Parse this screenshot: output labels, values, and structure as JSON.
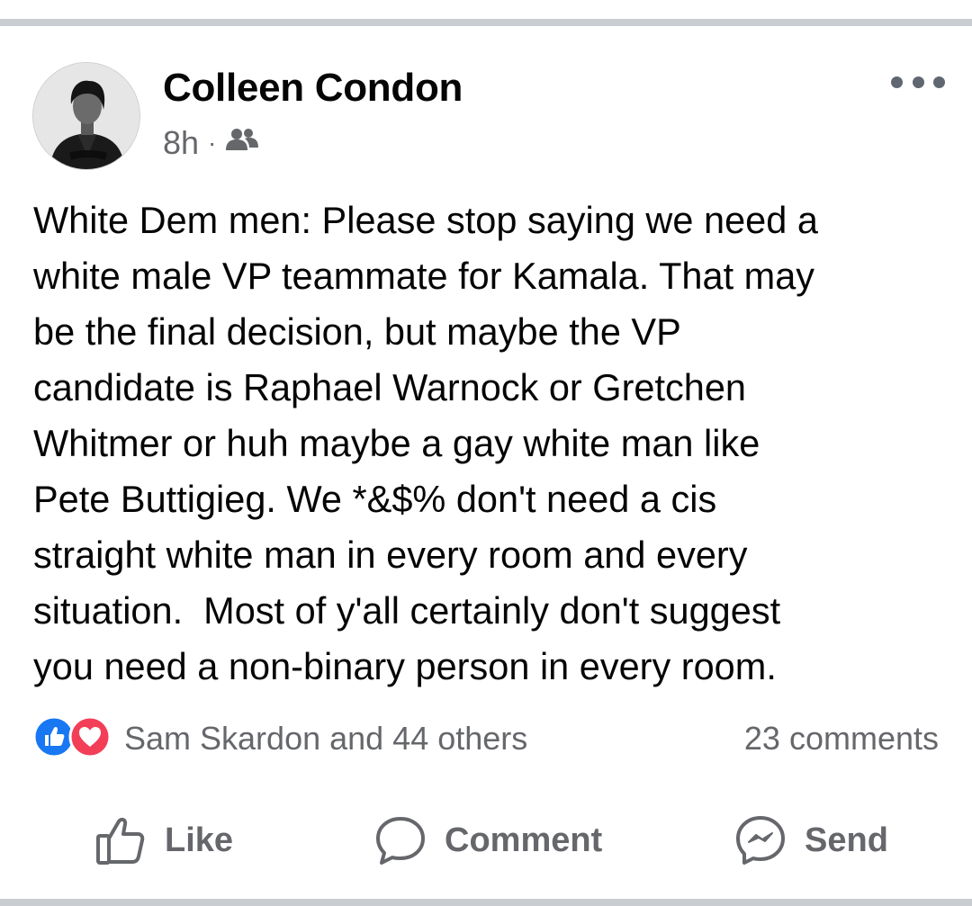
{
  "post": {
    "author_name": "Colleen Condon",
    "timestamp": "8h",
    "separator": "·",
    "audience_icon": "friends-icon",
    "text": "White Dem men: Please stop saying we need a\nwhite male VP teammate for Kamala. That may\nbe the final decision, but maybe the VP\ncandidate is Raphael Warnock or Gretchen\nWhitmer or huh maybe a gay white man like\nPete Buttigieg. We *&$% don't need a cis\nstraight white man in every room and every\nsituation.  Most of y'all certainly don't suggest\nyou need a non-binary person in every room.",
    "reactions": {
      "icons": [
        "like-reaction-icon",
        "love-reaction-icon"
      ],
      "summary": "Sam Skardon and 44 others"
    },
    "comments_count": "23 comments"
  },
  "actions": {
    "like_label": "Like",
    "comment_label": "Comment",
    "send_label": "Send"
  },
  "colors": {
    "like_blue": "#1877f2",
    "love_red": "#f33e58",
    "secondary_text": "#65676b",
    "primary_text": "#050505",
    "divider": "#c9ccd1"
  }
}
